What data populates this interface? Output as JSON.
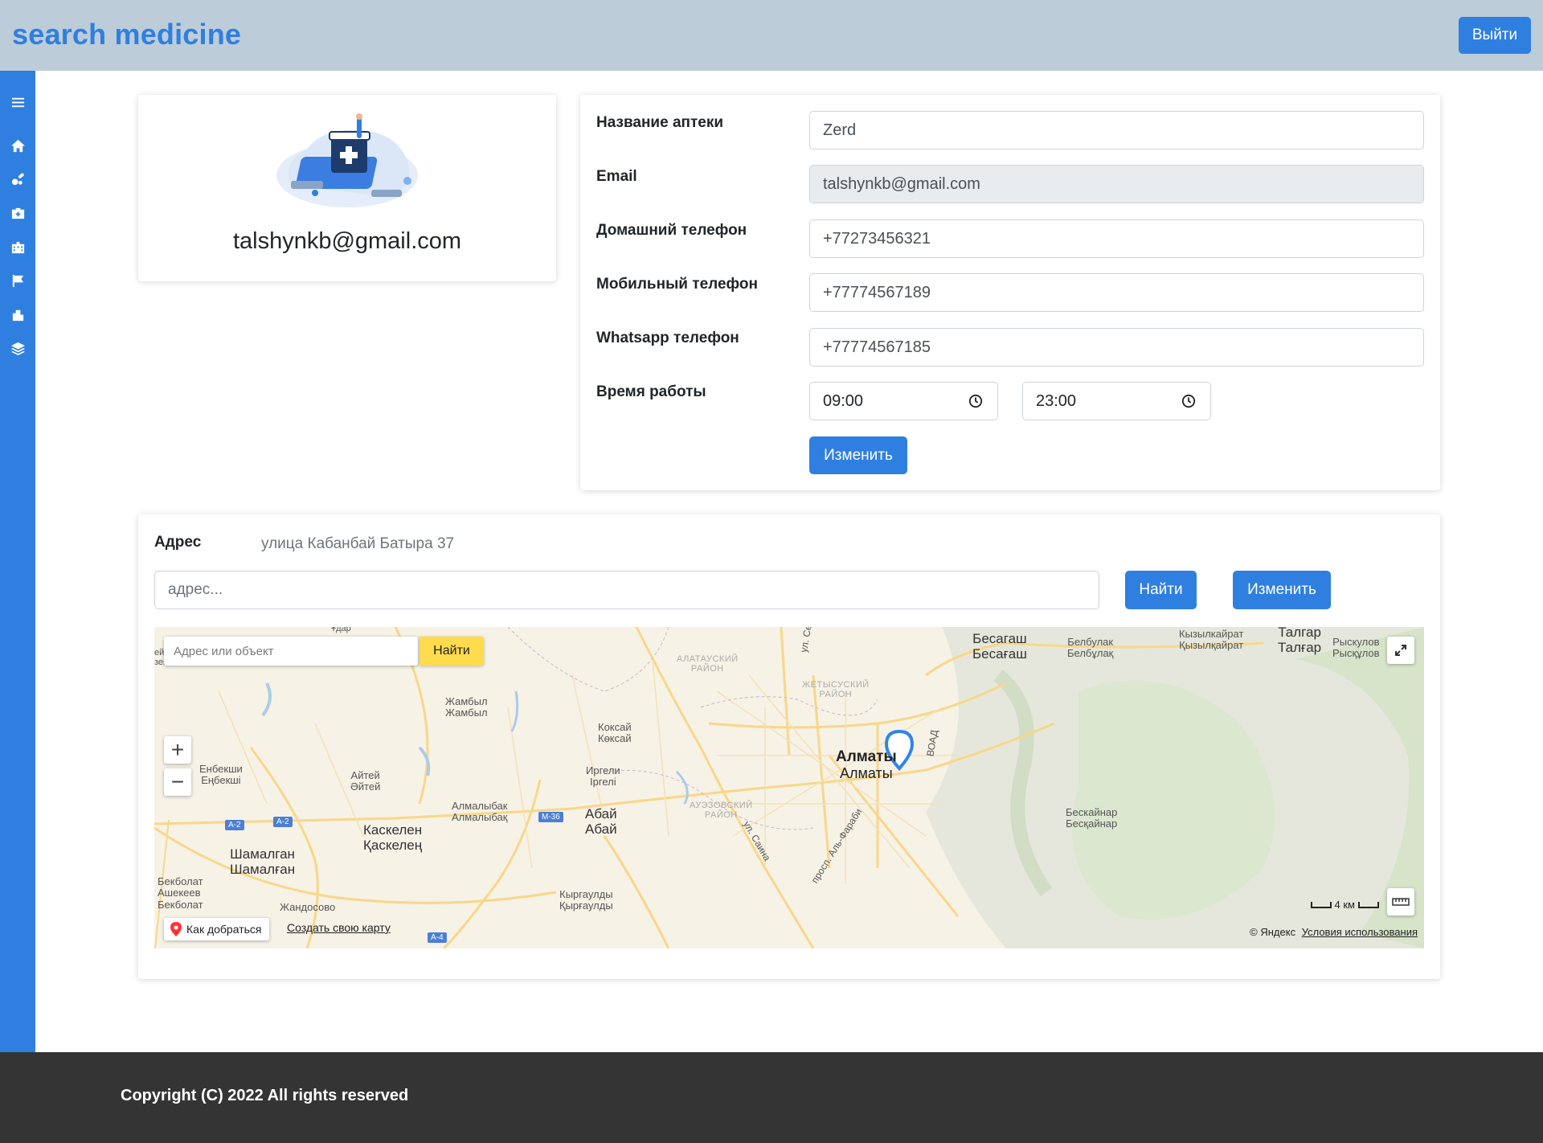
{
  "header": {
    "brand": "search medicine",
    "logout_label": "Выйти"
  },
  "sidebar": {
    "items": [
      {
        "icon": "menu-icon"
      },
      {
        "icon": "home-icon"
      },
      {
        "icon": "pills-icon"
      },
      {
        "icon": "first-aid-kit-icon"
      },
      {
        "icon": "building-icon"
      },
      {
        "icon": "flag-icon"
      },
      {
        "icon": "city-icon"
      },
      {
        "icon": "layers-icon"
      }
    ],
    "color": "#2f7fe0"
  },
  "profile": {
    "email": "talshynkb@gmail.com"
  },
  "form": {
    "name_label": "Название аптеки",
    "name_value": "Zerd",
    "email_label": "Email",
    "email_value": "talshynkb@gmail.com",
    "home_phone_label": "Домашний телефон",
    "home_phone_value": "+77273456321",
    "mobile_phone_label": "Мобильный телефон",
    "mobile_phone_value": "+77774567189",
    "whatsapp_label": "Whatsapp телефон",
    "whatsapp_value": "+77774567185",
    "hours_label": "Время работы",
    "open_time": "09:00",
    "close_time": "23:00",
    "submit_label": "Изменить"
  },
  "address": {
    "label": "Адрес",
    "value": "улица Кабанбай Батыра 37",
    "input_placeholder": "адрес...",
    "find_label": "Найти",
    "change_label": "Изменить"
  },
  "map": {
    "search_placeholder": "Адрес или объект",
    "search_button": "Найти",
    "zoom_in": "+",
    "zoom_out": "−",
    "route_label": "Как добраться",
    "create_map_label": "Создать свою карту",
    "scale_label": "4 км",
    "copyright": "© Яндекс",
    "terms_label": "Условия использования",
    "labels": {
      "besagash": "Бесагаш",
      "besagash2": "Бесағаш",
      "belbulak": "Белбулак",
      "belbulak2": "Белбұлақ",
      "kyzylkairat": "Кызылкайрат",
      "kyzylkairat2": "Қызылқайрат",
      "talgar": "Талгар",
      "talgar2": "Талғар",
      "ryskulov": "Рыскулов",
      "ryskulov2": "Рысқұлов",
      "alatau": "АЛАТАУСКИЙ",
      "alatau2": "РАЙОН",
      "zhetysu": "ЖЕТЫСУСКИЙ",
      "zhetysu2": "РАЙОН",
      "zhambyl": "Жамбыл",
      "zhambyl2": "Жамбыл",
      "koksai": "Коксай",
      "koksai2": "Көксай",
      "almaty": "Алматы",
      "almaty2": "Алматы",
      "vodd": "ВОАД",
      "enbekshi": "Енбекши",
      "enbekshi2": "Еңбекші",
      "aitei": "Айтей",
      "aitei2": "Әйтей",
      "irgeli": "Иргели",
      "irgeli2": "Іргелі",
      "almalybak": "Алмалыбак",
      "almalybak2": "Алмалыбақ",
      "abai": "Абай",
      "abai2": "Абай",
      "auezov": "АУЭЗОВСКИЙ",
      "auezov2": "РАЙОН",
      "kaskelen": "Каскелен",
      "kaskelen2": "Қаскелең",
      "beskainar": "Бескайнар",
      "beskainar2": "Бесқайнар",
      "shamalgan": "Шамалган",
      "shamalgan2": "Шамалған",
      "bekbolat": "Бекболат",
      "bekbolat2": "Ашекеев",
      "bekbolat3": "Бекболат",
      "zhandosovo": "Жандосово",
      "kyrgauldy": "Кыргаулды",
      "kyrgauldy2": "Қырғаулды",
      "sain": "ул. Саина",
      "alfarabi": "просп. Аль-Фараби",
      "a2": "A-2",
      "a2b": "A-2",
      "m36": "M-36",
      "a4": "A-4",
      "top_cut": "Ұдар",
      "left_cut1": "ей",
      "left_cut2": "зев",
      "seifullin": "ул. Се"
    }
  },
  "footer": {
    "text": "Copyright (C) 2022 All rights reserved"
  }
}
